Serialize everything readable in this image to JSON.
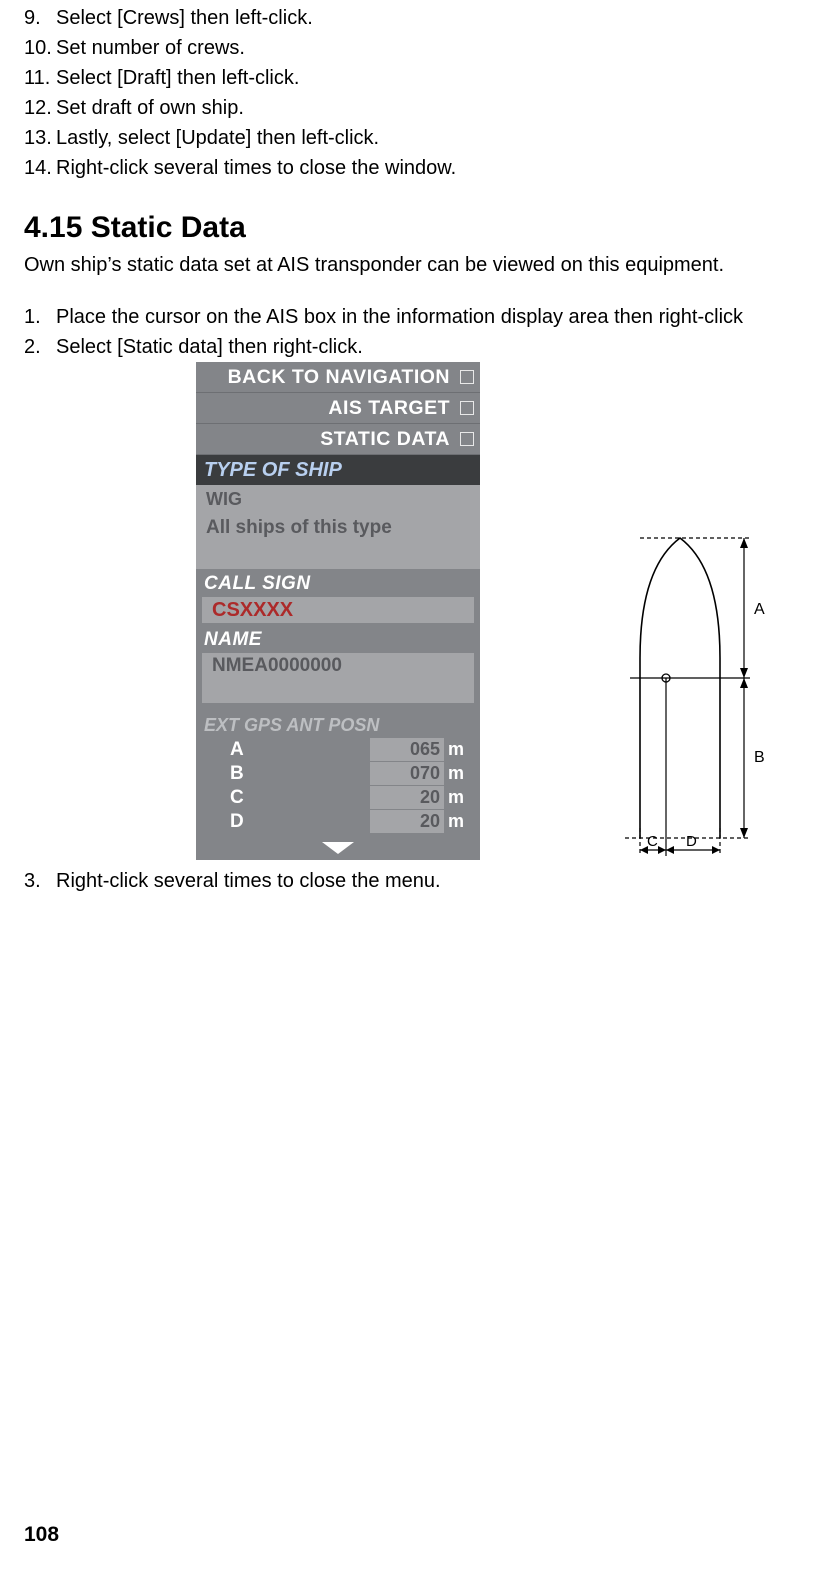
{
  "steps_a": [
    {
      "n": "9.",
      "t": "Select [Crews] then left-click."
    },
    {
      "n": "10.",
      "t": "Set number of crews."
    },
    {
      "n": "11.",
      "t": "Select [Draft] then left-click."
    },
    {
      "n": "12.",
      "t": "Set draft of own ship."
    },
    {
      "n": "13.",
      "t": "Lastly, select [Update] then left-click."
    },
    {
      "n": "14.",
      "t": "Right-click several times to close the window."
    }
  ],
  "section_title": "4.15 Static Data",
  "intro": "Own ship’s static data set at AIS transponder can be viewed on this equipment.",
  "steps_b": [
    {
      "n": "1.",
      "t": "Place the cursor on the AIS box in the information display area then right-click"
    },
    {
      "n": "2.",
      "t": "Select [Static data] then right-click."
    }
  ],
  "menu": {
    "top": [
      "BACK TO NAVIGATION",
      "AIS TARGET",
      "STATIC DATA"
    ],
    "type_header": "TYPE OF SHIP",
    "type_line1": "WIG",
    "type_line2": "All ships of this type",
    "callsign_header": "CALL SIGN",
    "callsign_value": "CSXXXX",
    "name_header": "NAME",
    "name_value": "NMEA0000000",
    "ant_header": "EXT GPS ANT POSN",
    "ant": [
      {
        "k": "A",
        "v": "065",
        "u": "m"
      },
      {
        "k": "B",
        "v": "070",
        "u": "m"
      },
      {
        "k": "C",
        "v": "20",
        "u": "m"
      },
      {
        "k": "D",
        "v": "20",
        "u": "m"
      }
    ]
  },
  "ship_labels": {
    "A": "A",
    "B": "B",
    "C": "C",
    "D": "D"
  },
  "steps_c": [
    {
      "n": "3.",
      "t": "Right-click several times to close the menu."
    }
  ],
  "page_number": "108"
}
